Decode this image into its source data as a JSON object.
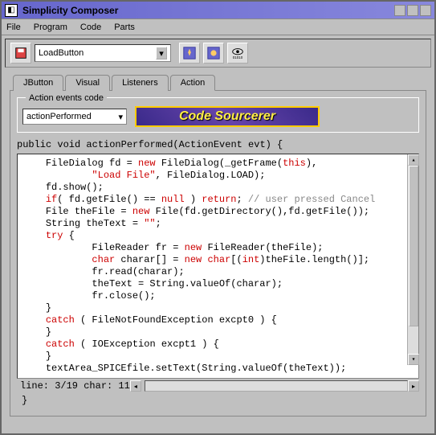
{
  "window": {
    "title": "Simplicity Composer"
  },
  "menubar": [
    "File",
    "Program",
    "Code",
    "Parts"
  ],
  "toolbar": {
    "combo_value": "LoadButton"
  },
  "tabs": [
    "JButton",
    "Visual",
    "Listeners",
    "Action"
  ],
  "active_tab": "Action",
  "fieldset": {
    "legend": "Action events code",
    "method_combo": "actionPerformed",
    "logo_text": "Code Sourcerer"
  },
  "code": {
    "sig": "public void actionPerformed(ActionEvent evt) {",
    "lines": [
      {
        "indent": 1,
        "tokens": [
          {
            "t": "FileDialog fd = "
          },
          {
            "t": "new",
            "c": "kw"
          },
          {
            "t": " FileDialog(_getFrame("
          },
          {
            "t": "this",
            "c": "kw"
          },
          {
            "t": "),"
          }
        ]
      },
      {
        "indent": 3,
        "tokens": [
          {
            "t": "\"Load File\"",
            "c": "kw"
          },
          {
            "t": ", FileDialog.LOAD);"
          }
        ]
      },
      {
        "indent": 1,
        "tokens": [
          {
            "t": "fd.show();"
          }
        ]
      },
      {
        "indent": 1,
        "tokens": [
          {
            "t": "if",
            "c": "kw"
          },
          {
            "t": "( fd.getFile() == "
          },
          {
            "t": "null",
            "c": "kw"
          },
          {
            "t": " ) "
          },
          {
            "t": "return",
            "c": "kw"
          },
          {
            "t": "; "
          },
          {
            "t": "// user pressed Cancel",
            "c": "cm"
          }
        ]
      },
      {
        "indent": 1,
        "tokens": [
          {
            "t": "File theFile = "
          },
          {
            "t": "new",
            "c": "kw"
          },
          {
            "t": " File(fd.getDirectory(),fd.getFile());"
          }
        ]
      },
      {
        "indent": 1,
        "tokens": [
          {
            "t": "String theText = "
          },
          {
            "t": "\"\"",
            "c": "kw"
          },
          {
            "t": ";"
          }
        ]
      },
      {
        "indent": 1,
        "tokens": [
          {
            "t": "try",
            "c": "kw"
          },
          {
            "t": " {"
          }
        ]
      },
      {
        "indent": 3,
        "tokens": [
          {
            "t": "FileReader fr = "
          },
          {
            "t": "new",
            "c": "kw"
          },
          {
            "t": " FileReader(theFile);"
          }
        ]
      },
      {
        "indent": 3,
        "tokens": [
          {
            "t": "char",
            "c": "kw"
          },
          {
            "t": " charar[] = "
          },
          {
            "t": "new",
            "c": "kw"
          },
          {
            "t": " "
          },
          {
            "t": "char",
            "c": "kw"
          },
          {
            "t": "[("
          },
          {
            "t": "int",
            "c": "kw"
          },
          {
            "t": ")theFile.length()];"
          }
        ]
      },
      {
        "indent": 3,
        "tokens": [
          {
            "t": "fr.read(charar);"
          }
        ]
      },
      {
        "indent": 3,
        "tokens": [
          {
            "t": "theText = String.valueOf(charar);"
          }
        ]
      },
      {
        "indent": 3,
        "tokens": [
          {
            "t": "fr.close();"
          }
        ]
      },
      {
        "indent": 1,
        "tokens": [
          {
            "t": "}"
          }
        ]
      },
      {
        "indent": 1,
        "tokens": [
          {
            "t": "catch",
            "c": "kw"
          },
          {
            "t": " ( FileNotFoundException excpt0 ) {"
          }
        ]
      },
      {
        "indent": 1,
        "tokens": [
          {
            "t": "}"
          }
        ]
      },
      {
        "indent": 1,
        "tokens": [
          {
            "t": "catch",
            "c": "kw"
          },
          {
            "t": " ( IOException excpt1 ) {"
          }
        ]
      },
      {
        "indent": 1,
        "tokens": [
          {
            "t": "}"
          }
        ]
      },
      {
        "indent": 1,
        "tokens": [
          {
            "t": "textArea_SPICEfile.setText(String.valueOf(theText));"
          }
        ]
      }
    ],
    "close": "}"
  },
  "status": {
    "line": "3/19",
    "char": "11",
    "text": "  line: 3/19   char: 11"
  }
}
